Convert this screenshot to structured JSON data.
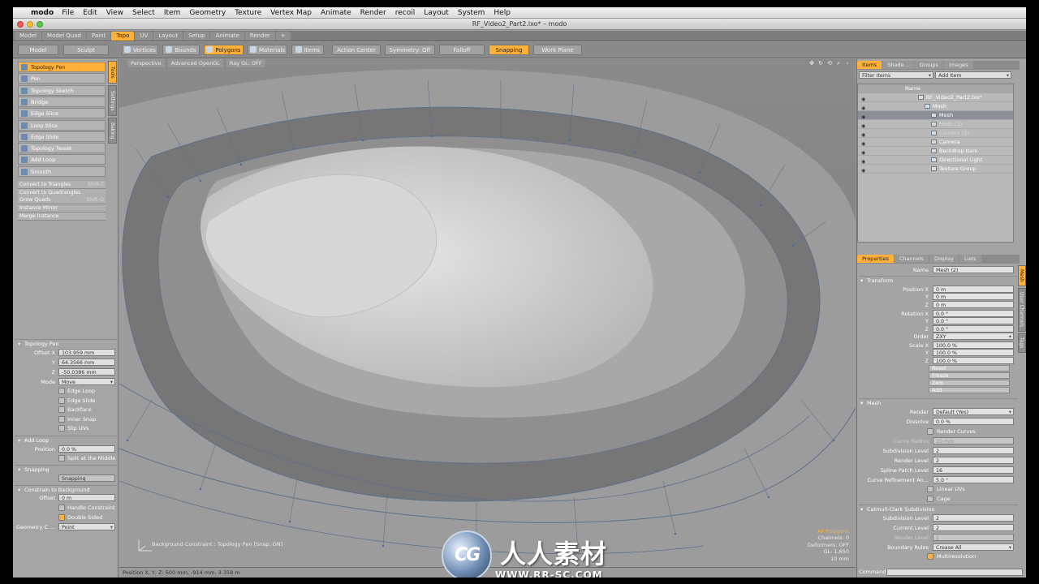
{
  "menubar": {
    "app": "modo",
    "items": [
      "File",
      "Edit",
      "View",
      "Select",
      "Item",
      "Geometry",
      "Texture",
      "Vertex Map",
      "Animate",
      "Render",
      "recoil",
      "Layout",
      "System",
      "Help"
    ]
  },
  "window": {
    "title": "RF_Video2_Part2.lxo* – modo"
  },
  "layout_tabs": [
    "Model",
    "Model Quad",
    "Paint",
    "Topo",
    "UV",
    "Layout",
    "Setup",
    "Animate",
    "Render",
    "+"
  ],
  "toolbar": {
    "model": "Model",
    "sculpt": "Sculpt",
    "vertices": "Vertices",
    "edges": "Bounds",
    "polygons": "Polygons",
    "materials": "Materials",
    "items": "Items",
    "action_center": "Action Center",
    "symmetry": "Symmetry: Off",
    "falloff": "Falloff",
    "snapping": "Snapping",
    "work_plane": "Work Plane"
  },
  "left": {
    "vtabs": [
      "Tools",
      "Settings",
      "Baking"
    ],
    "tools": [
      "Topology Pen",
      "Pen",
      "Topology Sketch",
      "Bridge",
      "Edge Slice",
      "Loop Slice",
      "Edge Slide",
      "Topology Tweak",
      "Add Loop",
      "Smooth"
    ],
    "commands": [
      {
        "label": "Convert to Triangles",
        "shortcut": "Shift-T"
      },
      {
        "label": "Convert to Quadrangles",
        "shortcut": ""
      },
      {
        "label": "Grow Quads",
        "shortcut": "Shift-Q"
      },
      {
        "label": "Instance Mirror",
        "shortcut": ""
      },
      {
        "label": "Merge Instance",
        "shortcut": ""
      }
    ],
    "topo_pen": {
      "title": "Topology Pen",
      "offset_x_label": "Offset X",
      "offset_x": "103.959 mm",
      "y_label": "Y",
      "y": "64.3566 mm",
      "z_label": "Z",
      "z": "-50.0386 mm",
      "mode_label": "Mode",
      "mode": "Move",
      "checks": [
        "Edge Loop",
        "Edge Slide",
        "Backface",
        "Inner Snap",
        "Slip UVs"
      ]
    },
    "add_loop": {
      "title": "Add Loop",
      "position_label": "Position",
      "position": "0.0 %",
      "split": "Split at the Middle"
    },
    "snapping": {
      "title": "Snapping",
      "button": "Snapping"
    },
    "constrain": {
      "title": "Constrain to Background",
      "offset_label": "Offset",
      "offset": "0 m",
      "handle": "Handle Constraint",
      "double": "Double Sided",
      "geo_label": "Geometry C ...",
      "geo": "Point"
    }
  },
  "viewport": {
    "header": [
      "Perspective",
      "Advanced OpenGL",
      "Ray GL: OFF"
    ],
    "info": [
      "All Polygons",
      "Channels: 0",
      "Deformers: OFF",
      "GL: 1,650",
      "10 mm"
    ],
    "status_text": "Background Constraint : Topology Pen  [Snap: ON]",
    "statusbar": "Position X, Y, Z:  500 mm, -914 mm, 3.358 m"
  },
  "items_panel": {
    "tabs": [
      "Items",
      "Shade...",
      "Groups",
      "Images"
    ],
    "filter": "Filter Items",
    "add": "Add Item",
    "header": "Name",
    "rows": [
      "RF_Video2_Part2.lxo*",
      "Mesh",
      "Mesh",
      "Mesh (2)",
      "Camera (2)",
      "Camera",
      "Backdrop Item",
      "Directional Light",
      "Texture Group"
    ]
  },
  "props_panel": {
    "tabs": [
      "Properties",
      "Channels",
      "Display",
      "Lists"
    ],
    "name_label": "Name",
    "name": "Mesh (2)",
    "transform_title": "Transform",
    "pos_labels": [
      "Position X",
      "Y",
      "Z"
    ],
    "pos": [
      "0 m",
      "0 m",
      "0 m"
    ],
    "rot_labels": [
      "Rotation X",
      "Y",
      "Z"
    ],
    "rot": [
      "0.0 °",
      "0.0 °",
      "0.0 °"
    ],
    "order_label": "Order",
    "order": "ZXY",
    "scale_labels": [
      "Scale X",
      "Y",
      "Z"
    ],
    "scale": [
      "100.0 %",
      "100.0 %",
      "100.0 %"
    ],
    "buttons": [
      "Reset",
      "Freeze",
      "Zero",
      "Add"
    ],
    "mesh_title": "Mesh",
    "render_label": "Render",
    "render": "Default (Yes)",
    "dissolve_label": "Dissolve",
    "dissolve": "0.0 %",
    "render_curves": "Render Curves",
    "curve_radius_label": "Curve Radius",
    "curve_radius": "10 mm",
    "subdiv_label": "Subdivision Level",
    "subdiv": "2",
    "render_level_label": "Render Level",
    "render_level": "2",
    "spline_label": "Spline Patch Level",
    "spline": "16",
    "curve_ref_label": "Curve Refinement An...",
    "curve_ref": "5.0 °",
    "linear_uvs": "Linear UVs",
    "cage": "Cage",
    "cc_title": "Catmull-Clark Subdivision",
    "cc_subdiv_label": "Subdivision Level",
    "cc_subdiv": "2",
    "cc_current_label": "Current Level",
    "cc_current": "2",
    "cc_render_label": "Render Level",
    "cc_render": "2",
    "boundary_label": "Boundary Rules",
    "boundary": "Crease All",
    "multires": "Multiresolution",
    "vtabs": [
      "Mesh",
      "User Channels",
      "Tags"
    ]
  },
  "command_label": "Command",
  "watermark": {
    "logo": "CG",
    "text": "人人素材",
    "url": "WWW.RR-SC.COM"
  }
}
